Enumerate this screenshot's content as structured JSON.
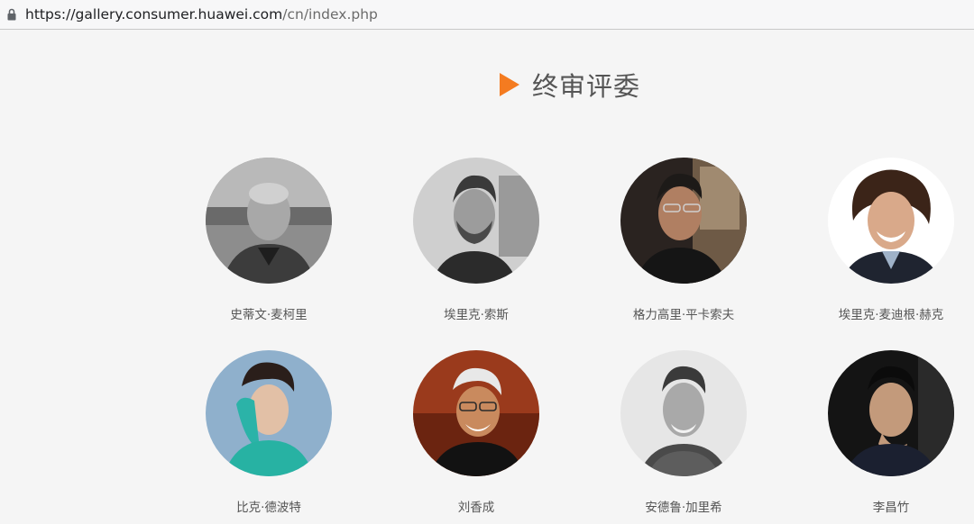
{
  "browser": {
    "url_host": "https://gallery.consumer.huawei.com",
    "url_path": "/cn/index.php",
    "lock_icon": "lock-icon"
  },
  "section": {
    "title": "终审评委",
    "marker_icon": "play-triangle-icon",
    "marker_color": "#f47b20"
  },
  "judges": [
    {
      "name": "史蒂文·麦柯里",
      "photo_tone": "grayscale"
    },
    {
      "name": "埃里克·索斯",
      "photo_tone": "grayscale"
    },
    {
      "name": "格力高里·平卡索夫",
      "photo_tone": "color"
    },
    {
      "name": "埃里克·麦迪根·赫克",
      "photo_tone": "color"
    },
    {
      "name": "比克·德波特",
      "photo_tone": "color"
    },
    {
      "name": "刘香成",
      "photo_tone": "color"
    },
    {
      "name": "安德鲁·加里希",
      "photo_tone": "grayscale"
    },
    {
      "name": "李昌竹",
      "photo_tone": "color"
    }
  ]
}
